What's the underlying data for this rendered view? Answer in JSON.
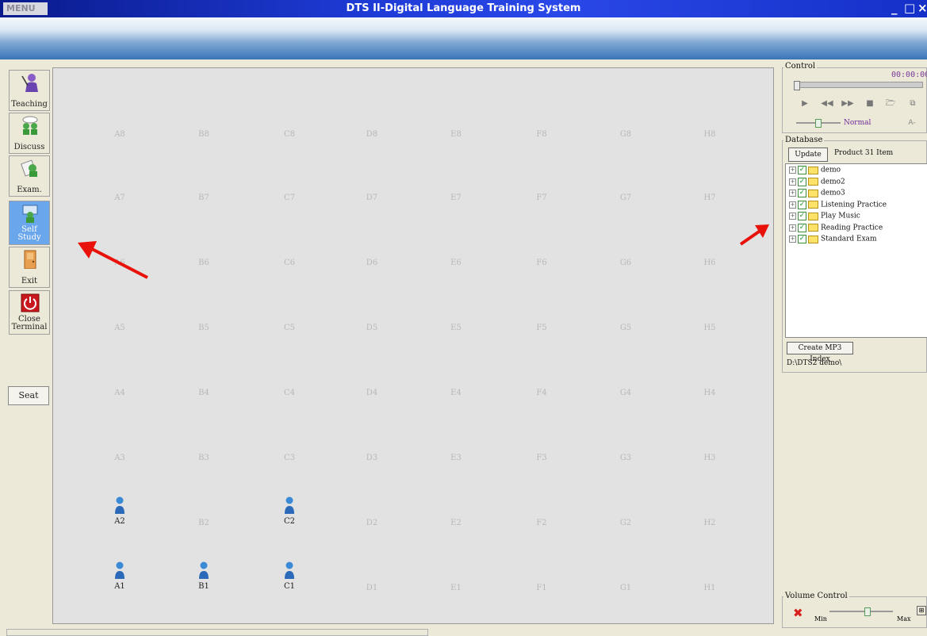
{
  "window": {
    "menu_label": "MENU",
    "title": "DTS II-Digital Language Training System",
    "minimize": "_",
    "maximize": "□",
    "close": "×"
  },
  "toolbar": {
    "items": [
      {
        "label": "Teaching",
        "icon": "teacher-icon"
      },
      {
        "label": "Discuss",
        "icon": "discuss-icon"
      },
      {
        "label": "Exam.",
        "icon": "exam-icon"
      },
      {
        "label": "Self Study",
        "icon": "self-study-icon",
        "active": true
      },
      {
        "label": "Exit",
        "icon": "door-icon"
      },
      {
        "label": "Close Terminal",
        "icon": "power-icon"
      }
    ],
    "seat_label": "Seat"
  },
  "grid": {
    "columns": [
      "A",
      "B",
      "C",
      "D",
      "E",
      "F",
      "G",
      "H"
    ],
    "rows": [
      "8",
      "7",
      "6",
      "5",
      "4",
      "3",
      "2",
      "1"
    ],
    "online": [
      "A2",
      "C2",
      "A1",
      "B1",
      "C1"
    ]
  },
  "control": {
    "label": "Control",
    "time": "00:00:00",
    "speed": "Normal",
    "font_size_glyph": "A-",
    "buttons": [
      "play-icon",
      "rewind-icon",
      "fast-forward-icon",
      "stop-icon",
      "open-folder-icon",
      "copy-icon"
    ]
  },
  "database": {
    "label": "Database",
    "update_label": "Update",
    "product_info": "Product 31 Item",
    "items": [
      "demo",
      "demo2",
      "demo3",
      "Listening Practice",
      "Play Music",
      "Reading Practice",
      "Standard Exam"
    ],
    "create_index_label": "Create MP3 Index",
    "path": "D:\\DTS2 demo\\"
  },
  "volume": {
    "label": "Volume Control",
    "min_label": "Min",
    "max_label": "Max"
  },
  "colors": {
    "title_bar": "#1e3bd6",
    "active_tool": "#6aa6ec",
    "arrow": "#e8120a",
    "time_text": "#7a3a9a"
  }
}
